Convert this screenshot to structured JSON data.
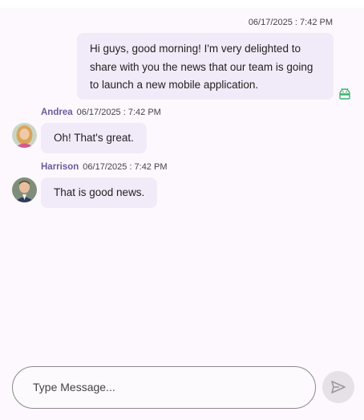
{
  "outgoing": {
    "timestamp": "06/17/2025 : 7:42 PM",
    "text": "Hi guys, good morning! I'm very delighted to share with you the news that our team is going to launch a new mobile application.",
    "status_icon": "android-icon"
  },
  "messages": [
    {
      "name": "Andrea",
      "timestamp": "06/17/2025 : 7:42 PM",
      "text": "Oh! That's great."
    },
    {
      "name": "Harrison",
      "timestamp": "06/17/2025 : 7:42 PM",
      "text": "That is good news."
    }
  ],
  "composer": {
    "placeholder": "Type Message...",
    "value": ""
  },
  "send": {
    "icon": "send-icon"
  },
  "colors": {
    "bubble": "#f1ebf9",
    "name": "#6c5a9e",
    "status_icon": "#3cb371",
    "background": "#fcf8fd"
  }
}
